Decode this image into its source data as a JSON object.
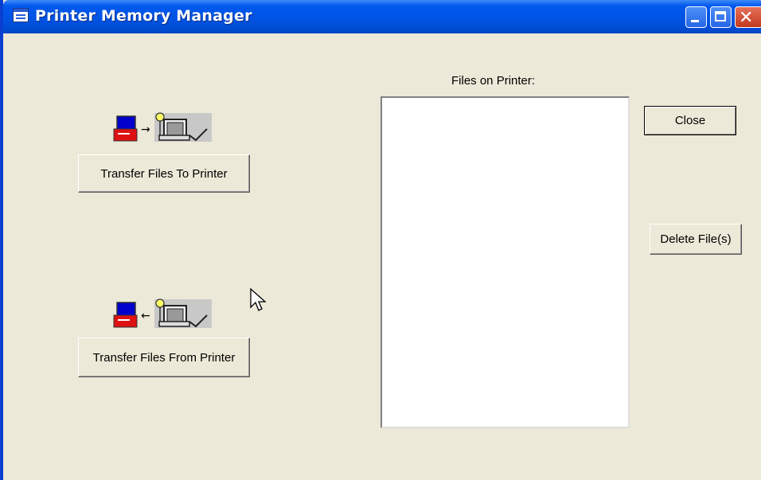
{
  "window": {
    "title": "Printer Memory Manager"
  },
  "left_panel": {
    "transfer_to_label": "Transfer Files To Printer",
    "transfer_from_label": "Transfer Files From Printer",
    "to_arrow": "→",
    "from_arrow": "←"
  },
  "files": {
    "label": "Files on Printer:",
    "items": []
  },
  "right_panel": {
    "close_label": "Close",
    "delete_label": "Delete File(s)"
  },
  "icons": [
    "app-icon",
    "minimize-icon",
    "maximize-icon",
    "close-icon",
    "pc-to-printer-icon",
    "printer-to-pc-icon",
    "mouse-cursor-icon"
  ]
}
